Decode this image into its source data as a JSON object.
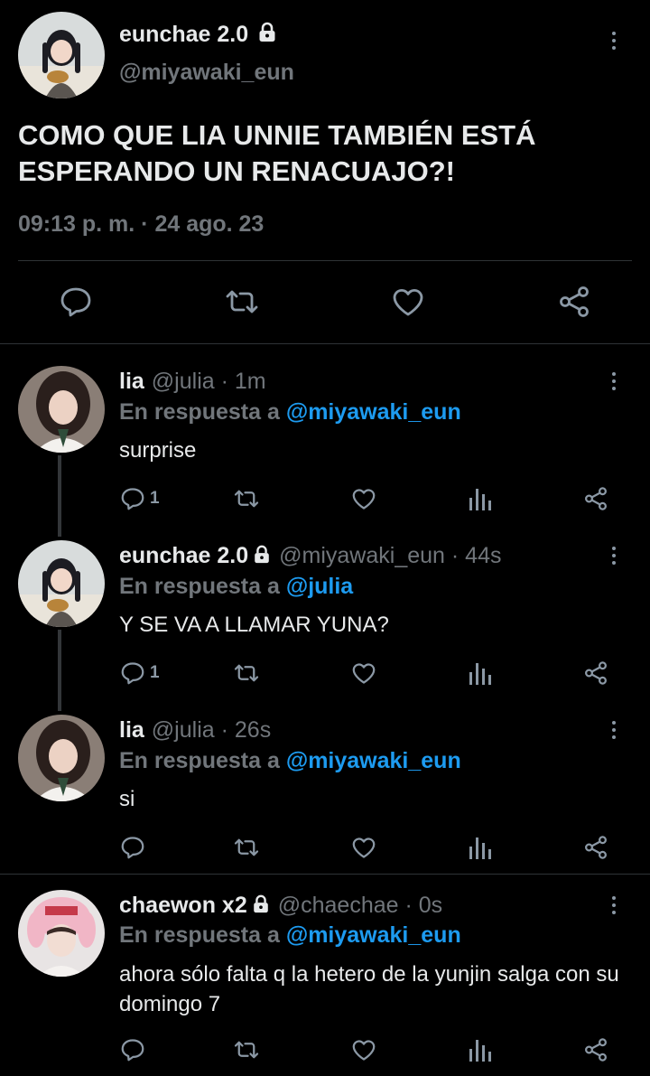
{
  "main_tweet": {
    "name": "eunchae 2.0",
    "handle": "@miyawaki_eun",
    "text": "COMO QUE LIA UNNIE TAMBIÉN ESTÁ ESPERANDO UN RENACUAJO?!",
    "timestamp": "09:13 p. m. · 24 ago. 23",
    "actions": [
      "reply-icon",
      "retweet-icon",
      "like-icon",
      "share-icon"
    ]
  },
  "replies": [
    {
      "name": "lia",
      "handle": "@julia",
      "time": "· 1m",
      "locked": false,
      "reply_prefix": "En respuesta a",
      "reply_to": "@miyawaki_eun",
      "text": "surprise",
      "reply_count": "1",
      "avatar": "lia"
    },
    {
      "name": "eunchae 2.0",
      "handle": "@miyawaki_eun",
      "time": "· 44s",
      "locked": true,
      "reply_prefix": "En respuesta a",
      "reply_to": "@julia",
      "text": "Y SE VA A LLAMAR YUNA?",
      "reply_count": "1",
      "avatar": "eunchae"
    },
    {
      "name": "lia",
      "handle": "@julia",
      "time": "· 26s",
      "locked": false,
      "reply_prefix": "En respuesta a",
      "reply_to": "@miyawaki_eun",
      "text": "si",
      "reply_count": "",
      "avatar": "lia"
    },
    {
      "name": "chaewon x2",
      "handle": "@chaechae",
      "time": "· 0s",
      "locked": true,
      "reply_prefix": "En respuesta a",
      "reply_to": "@miyawaki_eun",
      "text": "ahora sólo falta q la hetero de la yunjin salga con su domingo 7",
      "reply_count": "",
      "avatar": "chaewon"
    }
  ],
  "colors": {
    "background": "#000000",
    "text": "#e7e9ea",
    "muted": "#71767b",
    "icon": "#8b98a5",
    "accent": "#1d9bf0",
    "divider": "#2f3336"
  }
}
